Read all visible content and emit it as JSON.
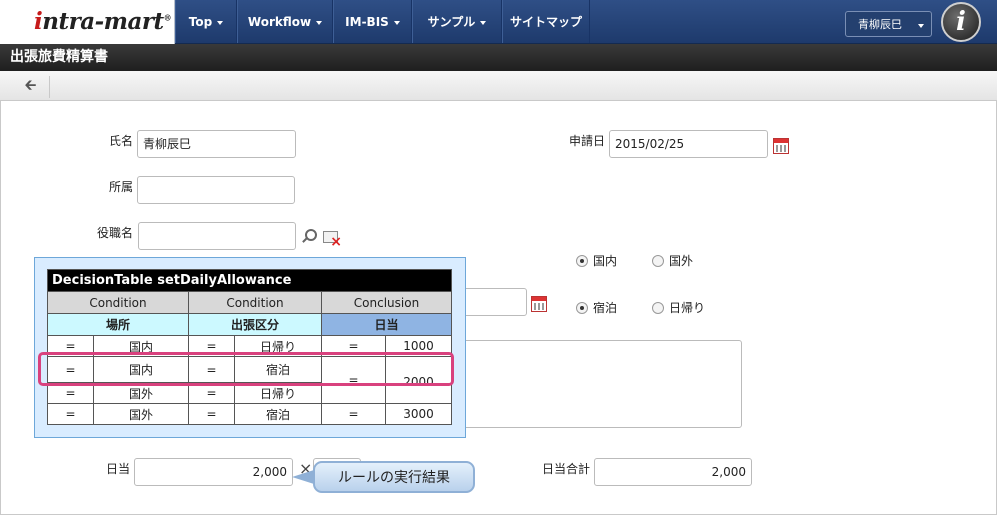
{
  "nav": {
    "items": [
      {
        "label": "Top",
        "dropdown": true
      },
      {
        "label": "Workflow",
        "dropdown": true
      },
      {
        "label": "IM-BIS",
        "dropdown": true
      },
      {
        "label": "サンプル",
        "dropdown": true
      },
      {
        "label": "サイトマップ",
        "dropdown": false
      }
    ],
    "user_name": "青柳辰巳"
  },
  "page": {
    "title": "出張旅費精算書"
  },
  "form": {
    "name_label": "氏名",
    "name_value": "青柳辰巳",
    "dept_label": "所属",
    "dept_value": "",
    "position_label": "役職名",
    "position_value": "",
    "apply_date_label": "申請日",
    "apply_date_value": "2015/02/25",
    "region_options": [
      "国内",
      "国外"
    ],
    "region_selected": "国内",
    "stay_options": [
      "宿泊",
      "日帰り"
    ],
    "stay_selected": "宿泊",
    "daily_label": "日当",
    "daily_value": "2,000",
    "times_symbol": "×",
    "daily_total_label": "日当合計",
    "daily_total_value": "2,000"
  },
  "decision_table": {
    "title": "DecisionTable setDailyAllowance",
    "headers": [
      "Condition",
      "Condition",
      "Conclusion"
    ],
    "subheaders": [
      "場所",
      "出張区分",
      "日当"
    ],
    "rows": [
      [
        "=",
        "国内",
        "=",
        "日帰り",
        "=",
        "1000"
      ],
      [
        "=",
        "国内",
        "=",
        "宿泊",
        "=",
        "2000"
      ],
      [
        "=",
        "国外",
        "=",
        "日帰り",
        "",
        ""
      ],
      [
        "=",
        "国外",
        "=",
        "宿泊",
        "=",
        "3000"
      ]
    ]
  },
  "callout": {
    "text": "ルールの実行結果"
  },
  "colors": {
    "nav_bg": "#2a4a80",
    "highlight": "#d9417e",
    "condition_sub": "#ccf9ff",
    "conclusion_sub": "#8fb4e3"
  }
}
